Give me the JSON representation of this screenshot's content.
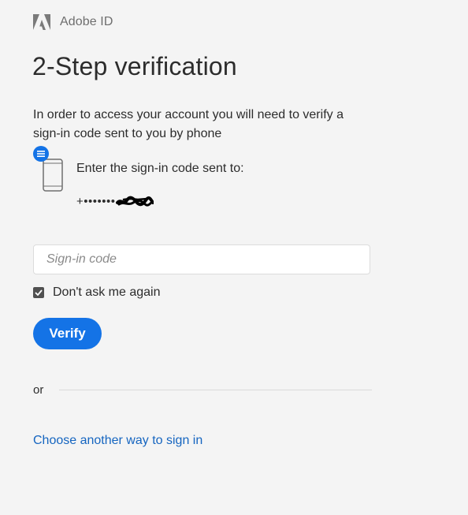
{
  "brand": {
    "name": "Adobe ID",
    "logo_icon": "adobe-logo-icon"
  },
  "page": {
    "title": "2-Step verification",
    "intro": "In order to access your account you will need to verify a sign-in code sent to you by phone"
  },
  "phone": {
    "icon": "mobile-phone-icon",
    "badge_icon": "menu-icon",
    "instruction": "Enter the sign-in code sent to:",
    "masked_number": "+•••••••"
  },
  "form": {
    "code_placeholder": "Sign-in code",
    "code_value": "",
    "remember_label": "Don't ask me again",
    "remember_checked": true,
    "verify_label": "Verify"
  },
  "divider": {
    "label": "or"
  },
  "alt_link": {
    "label": "Choose another way to sign in"
  },
  "colors": {
    "background": "#f4f4f4",
    "accent": "#1473e6",
    "link": "#1565c0",
    "text": "#2c2c2c",
    "muted": "#6e6e6e"
  }
}
